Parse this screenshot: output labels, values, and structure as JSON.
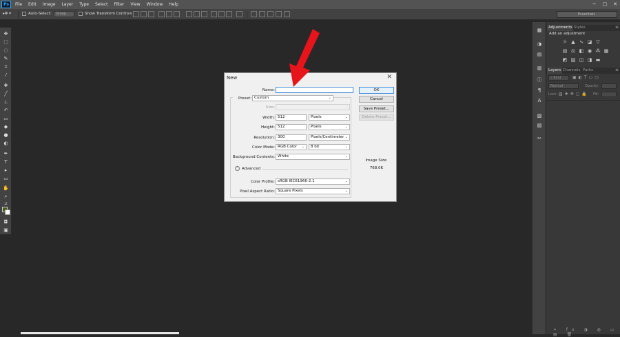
{
  "app": {
    "logo": "Ps"
  },
  "menu": [
    "File",
    "Edit",
    "Image",
    "Layer",
    "Type",
    "Select",
    "Filter",
    "View",
    "Window",
    "Help"
  ],
  "window_controls": [
    "−",
    "□",
    "✕"
  ],
  "options_bar": {
    "auto_select_label": "Auto-Select:",
    "auto_select_target": "Group",
    "show_transform_label": "Show Transform Controls"
  },
  "workspace": {
    "selected": "Essentials"
  },
  "right_panel": {
    "top_tabs": [
      "Adjustments",
      "Styles"
    ],
    "add_adjustment": "Add an adjustment",
    "layer_tabs": [
      "Layers",
      "Channels",
      "Paths"
    ],
    "kind_label": "Kind",
    "blend_mode": "Normal",
    "opacity_label": "Opacity:",
    "lock_label": "Lock:",
    "fill_label": "Fill:"
  },
  "dialog": {
    "title": "New",
    "close": "✕",
    "name_label": "Name:",
    "name_value": "",
    "preset_label": "Preset:",
    "preset_value": "Custom",
    "size_label": "Size:",
    "width_label": "Width:",
    "width_value": "512",
    "width_unit": "Pixels",
    "height_label": "Height:",
    "height_value": "512",
    "height_unit": "Pixels",
    "resolution_label": "Resolution:",
    "resolution_value": "300",
    "resolution_unit": "Pixels/Centimeter",
    "color_mode_label": "Color Mode:",
    "color_mode_value": "RGB Color",
    "bit_depth": "8 bit",
    "background_label": "Background Contents:",
    "background_value": "White",
    "advanced_label": "Advanced",
    "color_profile_label": "Color Profile:",
    "color_profile_value": "sRGB IEC61966-2.1",
    "pixel_aspect_label": "Pixel Aspect Ratio:",
    "pixel_aspect_value": "Square Pixels",
    "buttons": {
      "ok": "OK",
      "cancel": "Cancel",
      "save_preset": "Save Preset...",
      "delete_preset": "Delete Preset..."
    },
    "image_size_label": "Image Size:",
    "image_size_value": "768.0K"
  },
  "colors": {
    "arrow": "#e8141c",
    "accent": "#3f8ad8"
  }
}
